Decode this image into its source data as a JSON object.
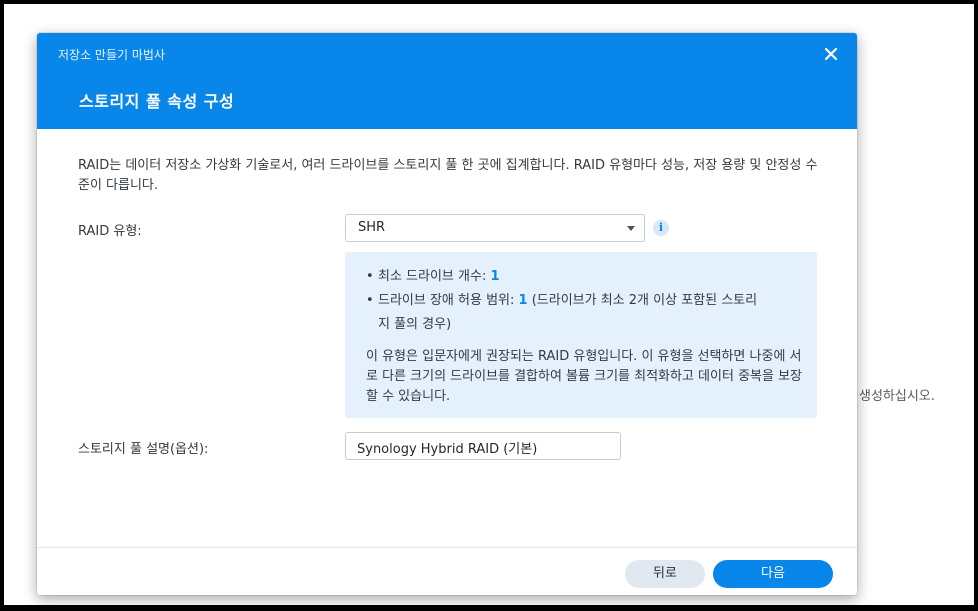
{
  "background": {
    "partial_text": "생성하십시오."
  },
  "dialog": {
    "wizard_title": "저장소 만들기 마법사",
    "step_title": "스토리지 풀 속성 구성",
    "close_icon": "close-icon",
    "description": "RAID는 데이터 저장소 가상화 기술로서, 여러 드라이브를 스토리지 풀 한 곳에 집계합니다. RAID 유형마다 성능, 저장 용량 및 안정성 수준이 다릅니다.",
    "raid_type": {
      "label": "RAID 유형:",
      "selected": "SHR",
      "info_icon": "i"
    },
    "info_panel": {
      "bullet1_label": "최소 드라이브 개수:",
      "bullet1_value": "1",
      "bullet2_label": "드라이브 장애 허용 범위:",
      "bullet2_value": "1",
      "bullet2_note_line1": "(드라이브가 최소 2개 이상 포함된 스토리",
      "bullet2_note_line2": "지 풀의 경우)",
      "note": "이 유형은 입문자에게 권장되는 RAID 유형입니다. 이 유형을 선택하면 나중에 서로 다른 크기의 드라이브를 결합하여 볼륨 크기를 최적화하고 데이터 중복을 보장할 수 있습니다."
    },
    "pool_description": {
      "label": "스토리지 풀 설명(옵션):",
      "value": "Synology Hybrid RAID (기본)"
    },
    "buttons": {
      "back": "뒤로",
      "next": "다음"
    }
  },
  "colors": {
    "accent": "#0986ea",
    "info_bg": "#e4f0fc",
    "back_button_bg": "#e2e8f0"
  }
}
